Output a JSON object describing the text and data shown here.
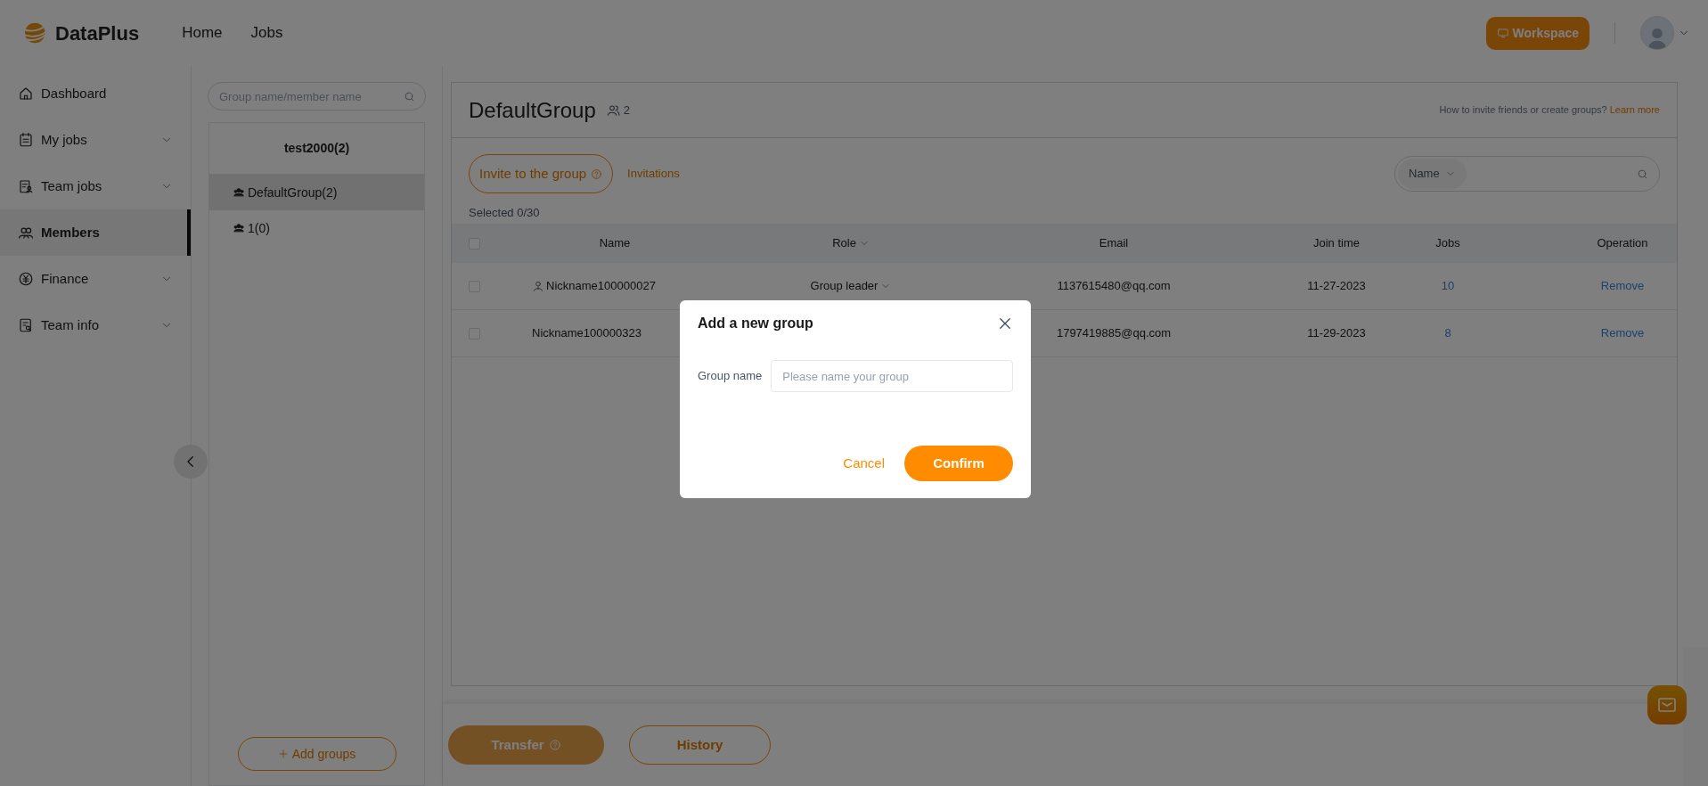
{
  "header": {
    "logo": "DataPlus",
    "nav": [
      {
        "label": "Home"
      },
      {
        "label": "Jobs"
      }
    ],
    "workspace_button": "Workspace"
  },
  "sidebar": {
    "items": [
      {
        "label": "Dashboard",
        "expandable": false,
        "selected": false
      },
      {
        "label": "My jobs",
        "expandable": true,
        "selected": false
      },
      {
        "label": "Team jobs",
        "expandable": true,
        "selected": false
      },
      {
        "label": "Members",
        "expandable": false,
        "selected": true
      },
      {
        "label": "Finance",
        "expandable": true,
        "selected": false
      },
      {
        "label": "Team info",
        "expandable": true,
        "selected": false
      }
    ]
  },
  "groups": {
    "search_placeholder": "Group name/member name",
    "team": "test2000(2)",
    "items": [
      {
        "label": "DefaultGroup(2)",
        "selected": true
      },
      {
        "label": "1(0)",
        "selected": false
      }
    ],
    "add_button": "Add groups"
  },
  "main": {
    "title": "DefaultGroup",
    "member_count": "2",
    "help_text": "How to invite friends or create groups?",
    "help_link": "Learn more",
    "invite_button": "Invite to the group",
    "invitations_link": "Invitations",
    "search_field": "Name",
    "selected_count": "Selected 0/30",
    "table": {
      "all_checked": false,
      "columns": [
        "Name",
        "Role",
        "Email",
        "Join time",
        "Jobs",
        "Operation"
      ],
      "rows": [
        {
          "checked": false,
          "leader": true,
          "name": "Nickname100000027",
          "role": "Group leader",
          "email": "1137615480@qq.com",
          "join_time": "11-27-2023",
          "jobs": "10",
          "operation": "Remove"
        },
        {
          "checked": false,
          "leader": false,
          "name": "Nickname100000323",
          "email": "1797419885@qq.com",
          "join_time": "11-29-2023",
          "jobs": "8",
          "operation": "Remove"
        }
      ]
    }
  },
  "bottom": {
    "transfer_button": "Transfer",
    "transfer_disabled": true,
    "history_button": "History"
  },
  "dialog": {
    "title": "Add a new group",
    "field_label": "Group name",
    "placeholder": "Please name your group",
    "cancel": "Cancel",
    "confirm": "Confirm"
  }
}
